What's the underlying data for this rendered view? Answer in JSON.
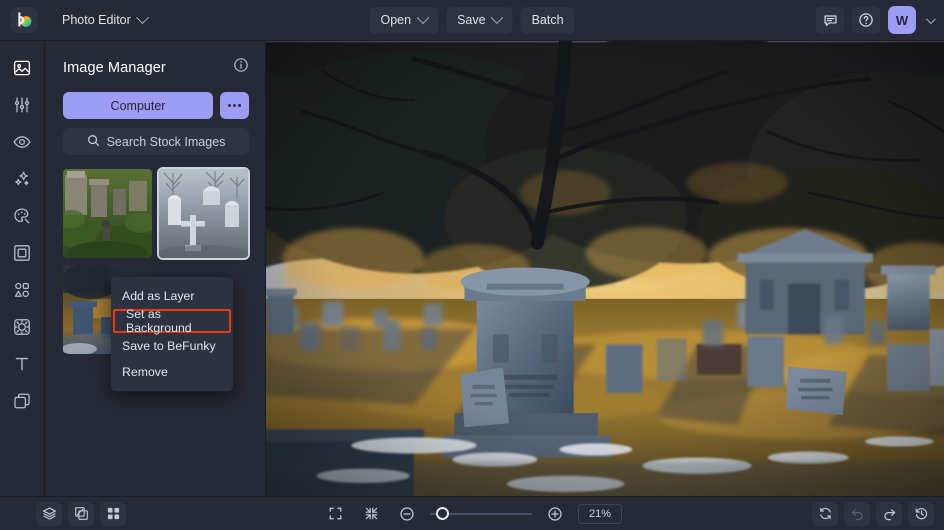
{
  "app": {
    "logo_icon": "befunky-logo-icon",
    "product_label": "Photo Editor"
  },
  "topbar": {
    "open_label": "Open",
    "save_label": "Save",
    "batch_label": "Batch",
    "feedback_icon": "chat-bubble-icon",
    "help_icon": "question-circle-icon",
    "avatar_initial": "W"
  },
  "rail": {
    "items": [
      {
        "icon": "image-manager-icon",
        "name": "image-manager",
        "active": true
      },
      {
        "icon": "sliders-icon",
        "name": "edit-adjust",
        "active": false
      },
      {
        "icon": "eye-icon",
        "name": "touch-up",
        "active": false
      },
      {
        "icon": "sparkles-icon",
        "name": "effects",
        "active": false
      },
      {
        "icon": "palette-icon",
        "name": "artsy",
        "active": false
      },
      {
        "icon": "frame-icon",
        "name": "frames",
        "active": false
      },
      {
        "icon": "shapes-icon",
        "name": "graphics",
        "active": false
      },
      {
        "icon": "texture-icon",
        "name": "textures",
        "active": false
      },
      {
        "icon": "text-icon",
        "name": "text",
        "active": false
      },
      {
        "icon": "layers-overlay-icon",
        "name": "overlays",
        "active": false
      }
    ]
  },
  "panel": {
    "title": "Image Manager",
    "info_icon": "info-circle-icon",
    "computer_label": "Computer",
    "more_icon": "ellipsis-icon",
    "search_icon": "search-icon",
    "search_placeholder": "Search Stock Images",
    "thumbnails": [
      {
        "name": "thumbnail-green-cemetery",
        "selected": false
      },
      {
        "name": "thumbnail-bw-cemetery",
        "selected": true
      },
      {
        "name": "thumbnail-sunset-cemetery",
        "selected": false
      }
    ]
  },
  "context_menu": {
    "items": [
      {
        "label": "Add as Layer",
        "highlighted": false
      },
      {
        "label": "Set as Background",
        "highlighted": true
      },
      {
        "label": "Save to BeFunky",
        "highlighted": false
      },
      {
        "label": "Remove",
        "highlighted": false
      }
    ],
    "highlight_color": "#f0380f"
  },
  "canvas": {
    "image_name": "cemetery-at-sunset-photo"
  },
  "bottombar": {
    "layers_icon": "layers-icon",
    "compare_icon": "compare-icon",
    "grid_icon": "grid-icon",
    "fit_icon": "fit-to-screen-icon",
    "shrink_icon": "collapse-icon",
    "zoom_out_icon": "zoom-out-icon",
    "zoom_in_icon": "zoom-in-icon",
    "zoom_value": "21%",
    "reset_icon": "reset-icon",
    "undo_icon": "undo-icon",
    "redo_icon": "redo-icon",
    "history_icon": "history-icon"
  },
  "colors": {
    "chrome": "#262a37",
    "canvas_bg": "#1b1e28",
    "accent": "#9d9df6",
    "highlight": "#f0380f"
  }
}
